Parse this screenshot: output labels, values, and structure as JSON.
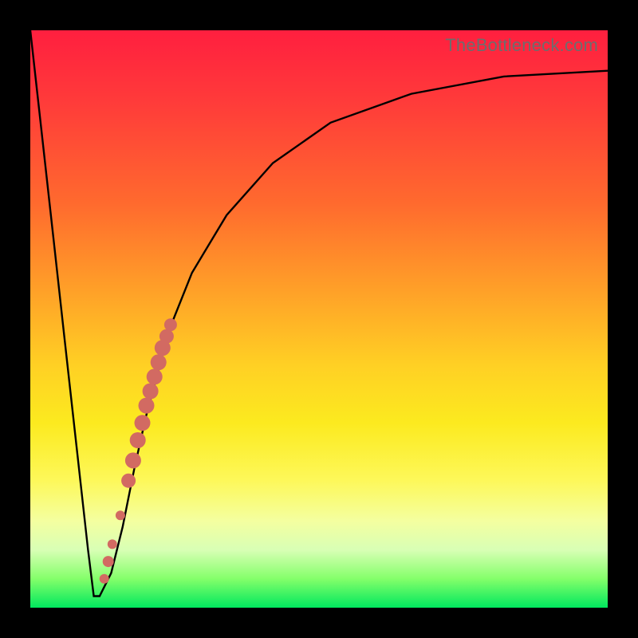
{
  "watermark": "TheBottleneck.com",
  "chart_data": {
    "type": "line",
    "title": "",
    "xlabel": "",
    "ylabel": "",
    "xlim": [
      0,
      100
    ],
    "ylim": [
      0,
      100
    ],
    "annotations": [],
    "series": [
      {
        "name": "bottleneck-curve",
        "x": [
          0,
          2,
          4,
          6,
          8,
          10,
          11,
          12,
          14,
          16,
          18,
          20,
          24,
          28,
          34,
          42,
          52,
          66,
          82,
          100
        ],
        "y": [
          100,
          82,
          64,
          46,
          28,
          10,
          2,
          2,
          6,
          14,
          24,
          33,
          48,
          58,
          68,
          77,
          84,
          89,
          92,
          93
        ]
      }
    ],
    "highlight_points": {
      "name": "highlight-dots",
      "color": "#d26a62",
      "x": [
        12.8,
        13.5,
        14.2,
        15.6,
        17.0,
        17.8,
        18.6,
        19.4,
        20.1,
        20.8,
        21.5,
        22.2,
        22.9,
        23.6,
        24.3
      ],
      "y": [
        5.0,
        8.0,
        11.0,
        16.0,
        22.0,
        25.5,
        29.0,
        32.0,
        35.0,
        37.5,
        40.0,
        42.5,
        45.0,
        47.0,
        49.0
      ],
      "r": [
        6,
        7,
        6,
        6,
        9,
        10,
        10,
        10,
        10,
        10,
        10,
        10,
        10,
        9,
        8
      ]
    }
  }
}
